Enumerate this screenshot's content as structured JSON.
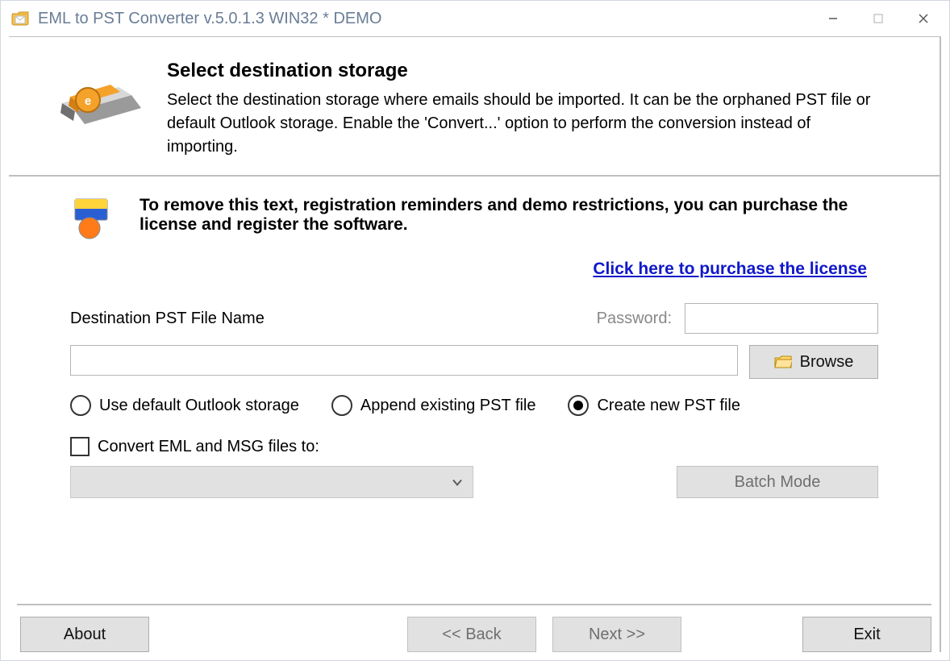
{
  "window": {
    "title": "EML to PST Converter v.5.0.1.3 WIN32 * DEMO"
  },
  "header": {
    "heading": "Select destination storage",
    "description": "Select the destination storage where emails should be imported. It can be the orphaned PST file or default Outlook storage. Enable the 'Convert...' option to perform the conversion instead of importing."
  },
  "demo_notice": {
    "text": "To remove this text, registration reminders and demo restrictions, you can purchase the license and register the software.",
    "purchase_link_label": "Click here to purchase the license"
  },
  "form": {
    "dest_label": "Destination PST File Name",
    "password_label": "Password:",
    "password_value": "",
    "dest_value": "",
    "browse_label": "Browse",
    "radio_options": {
      "use_default": "Use default Outlook storage",
      "append_existing": "Append existing PST file",
      "create_new": "Create new PST file"
    },
    "radio_selected": "create_new",
    "convert_checkbox_label": "Convert EML and MSG files to:",
    "convert_checkbox_checked": false,
    "convert_select_value": "",
    "batch_mode_label": "Batch Mode"
  },
  "footer": {
    "about_label": "About",
    "back_label": "<< Back",
    "next_label": "Next >>",
    "exit_label": "Exit"
  }
}
